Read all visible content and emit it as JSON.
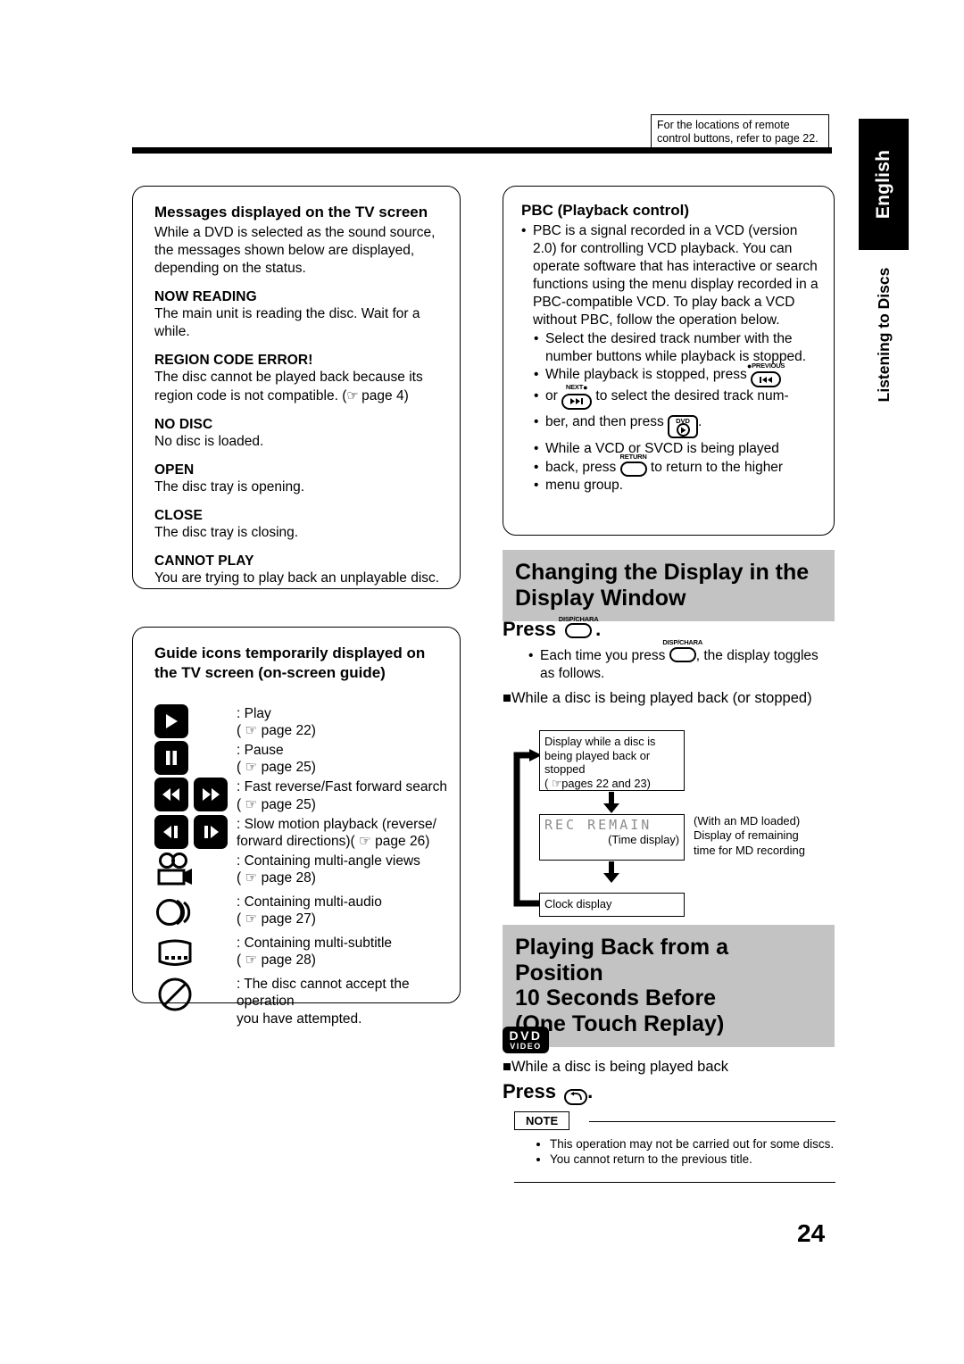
{
  "header": {
    "remote_note": "For the locations of remote control buttons, refer to page 22."
  },
  "side": {
    "language_tab": "English",
    "section_label": "Listening to Discs"
  },
  "messages_panel": {
    "title": "Messages displayed on the TV screen",
    "intro": "While a DVD is selected as the sound source, the messages shown below are displayed, depending on the status.",
    "entries": [
      {
        "term": "NOW READING",
        "desc": "The main unit is reading the disc. Wait for a while."
      },
      {
        "term": "REGION CODE ERROR!",
        "desc_pre": "The disc cannot be played back because its region code is not compatible. (",
        "ref": "page 4",
        "desc_post": ")"
      },
      {
        "term": "NO DISC",
        "desc": "No disc is loaded."
      },
      {
        "term": "OPEN",
        "desc": "The disc tray is opening."
      },
      {
        "term": "CLOSE",
        "desc": "The disc tray is closing."
      },
      {
        "term": "CANNOT PLAY",
        "desc": "You are trying to play back an unplayable disc."
      }
    ]
  },
  "guide_panel": {
    "title": "Guide icons temporarily displayed on the TV screen (on-screen guide)",
    "rows": [
      {
        "icon": "play-icon",
        "label": ": Play",
        "ref": "( ☞ page 22)"
      },
      {
        "icon": "pause-icon",
        "label": ": Pause",
        "ref": "( ☞ page 25)"
      },
      {
        "icon": "fast-rev-fwd-icon",
        "label": ": Fast reverse/Fast forward search",
        "ref": "( ☞ page 25)"
      },
      {
        "icon": "slow-motion-icon",
        "label": ": Slow motion playback (reverse/",
        "ref": "forward directions)( ☞ page 26)"
      },
      {
        "icon": "multi-angle-icon",
        "label": ": Containing multi-angle views",
        "ref": "( ☞ page 28)"
      },
      {
        "icon": "multi-audio-icon",
        "label": ": Containing multi-audio",
        "ref": "( ☞ page 27)"
      },
      {
        "icon": "multi-subtitle-icon",
        "label": ": Containing multi-subtitle",
        "ref": "( ☞ page 28)"
      },
      {
        "icon": "prohibited-icon",
        "label": ": The disc cannot accept the operation",
        "ref": "you have attempted."
      }
    ]
  },
  "pbc_panel": {
    "title": "PBC (Playback control)",
    "intro": "PBC is a signal recorded in a VCD (version 2.0) for controlling VCD playback. You can operate software that has interactive or search functions using the menu display recorded in a PBC-compatible VCD. To play back a VCD without PBC, follow the operation below.",
    "sub1": "Select the desired track number with the number buttons while playback is stopped.",
    "sub2_a": "While playback is stopped, press",
    "sub2_b": "or",
    "sub2_c": "to select the desired track num-",
    "sub2_d": "ber, and then press",
    "sub2_e": ".",
    "sub3_a": "While a VCD or SVCD is being played",
    "sub3_b": "back, press",
    "sub3_c": "to return to the higher",
    "sub3_d": "menu group.",
    "button_previous": "PREVIOUS",
    "button_next": "NEXT",
    "button_dvd": "DVD",
    "button_return": "RETURN"
  },
  "display_section": {
    "heading_line1": "Changing the Display in the",
    "heading_line2": "Display Window",
    "press_label": "Press",
    "press_button": "DISP/CHARA",
    "press_period": ".",
    "note_a": "Each time you press",
    "note_b": ", the display toggles as follows.",
    "subhead": "While a disc is being played back (or stopped)",
    "flow": {
      "box1_l1": "Display while a disc is",
      "box1_l2": "being played back or",
      "box1_l3": "stopped",
      "box1_l4": "( ☞pages 22 and 23)",
      "box2_lcd": "REC REMAIN",
      "box2_sub": "(Time display)",
      "box3": "Clock display",
      "side_note_l1": "(With an MD loaded)",
      "side_note_l2": "Display of remaining",
      "side_note_l3": "time for MD recording"
    }
  },
  "replay_section": {
    "heading_line1": "Playing Back from a Position",
    "heading_line2": "10 Seconds Before",
    "heading_line3": "(One Touch Replay)",
    "badge_line1": "DVD",
    "badge_line2": "VIDEO",
    "subhead": "While a disc is being played back",
    "press_label": "Press",
    "press_period": ".",
    "note_tab": "NOTE",
    "notes": [
      "This operation may not be carried out for some discs.",
      "You cannot return to the previous title."
    ]
  },
  "footer": {
    "page_number": "24"
  },
  "colors": {
    "gray_heading": "#c3c3c3",
    "black": "#000000",
    "lcd_gray": "#8c8c8c"
  }
}
